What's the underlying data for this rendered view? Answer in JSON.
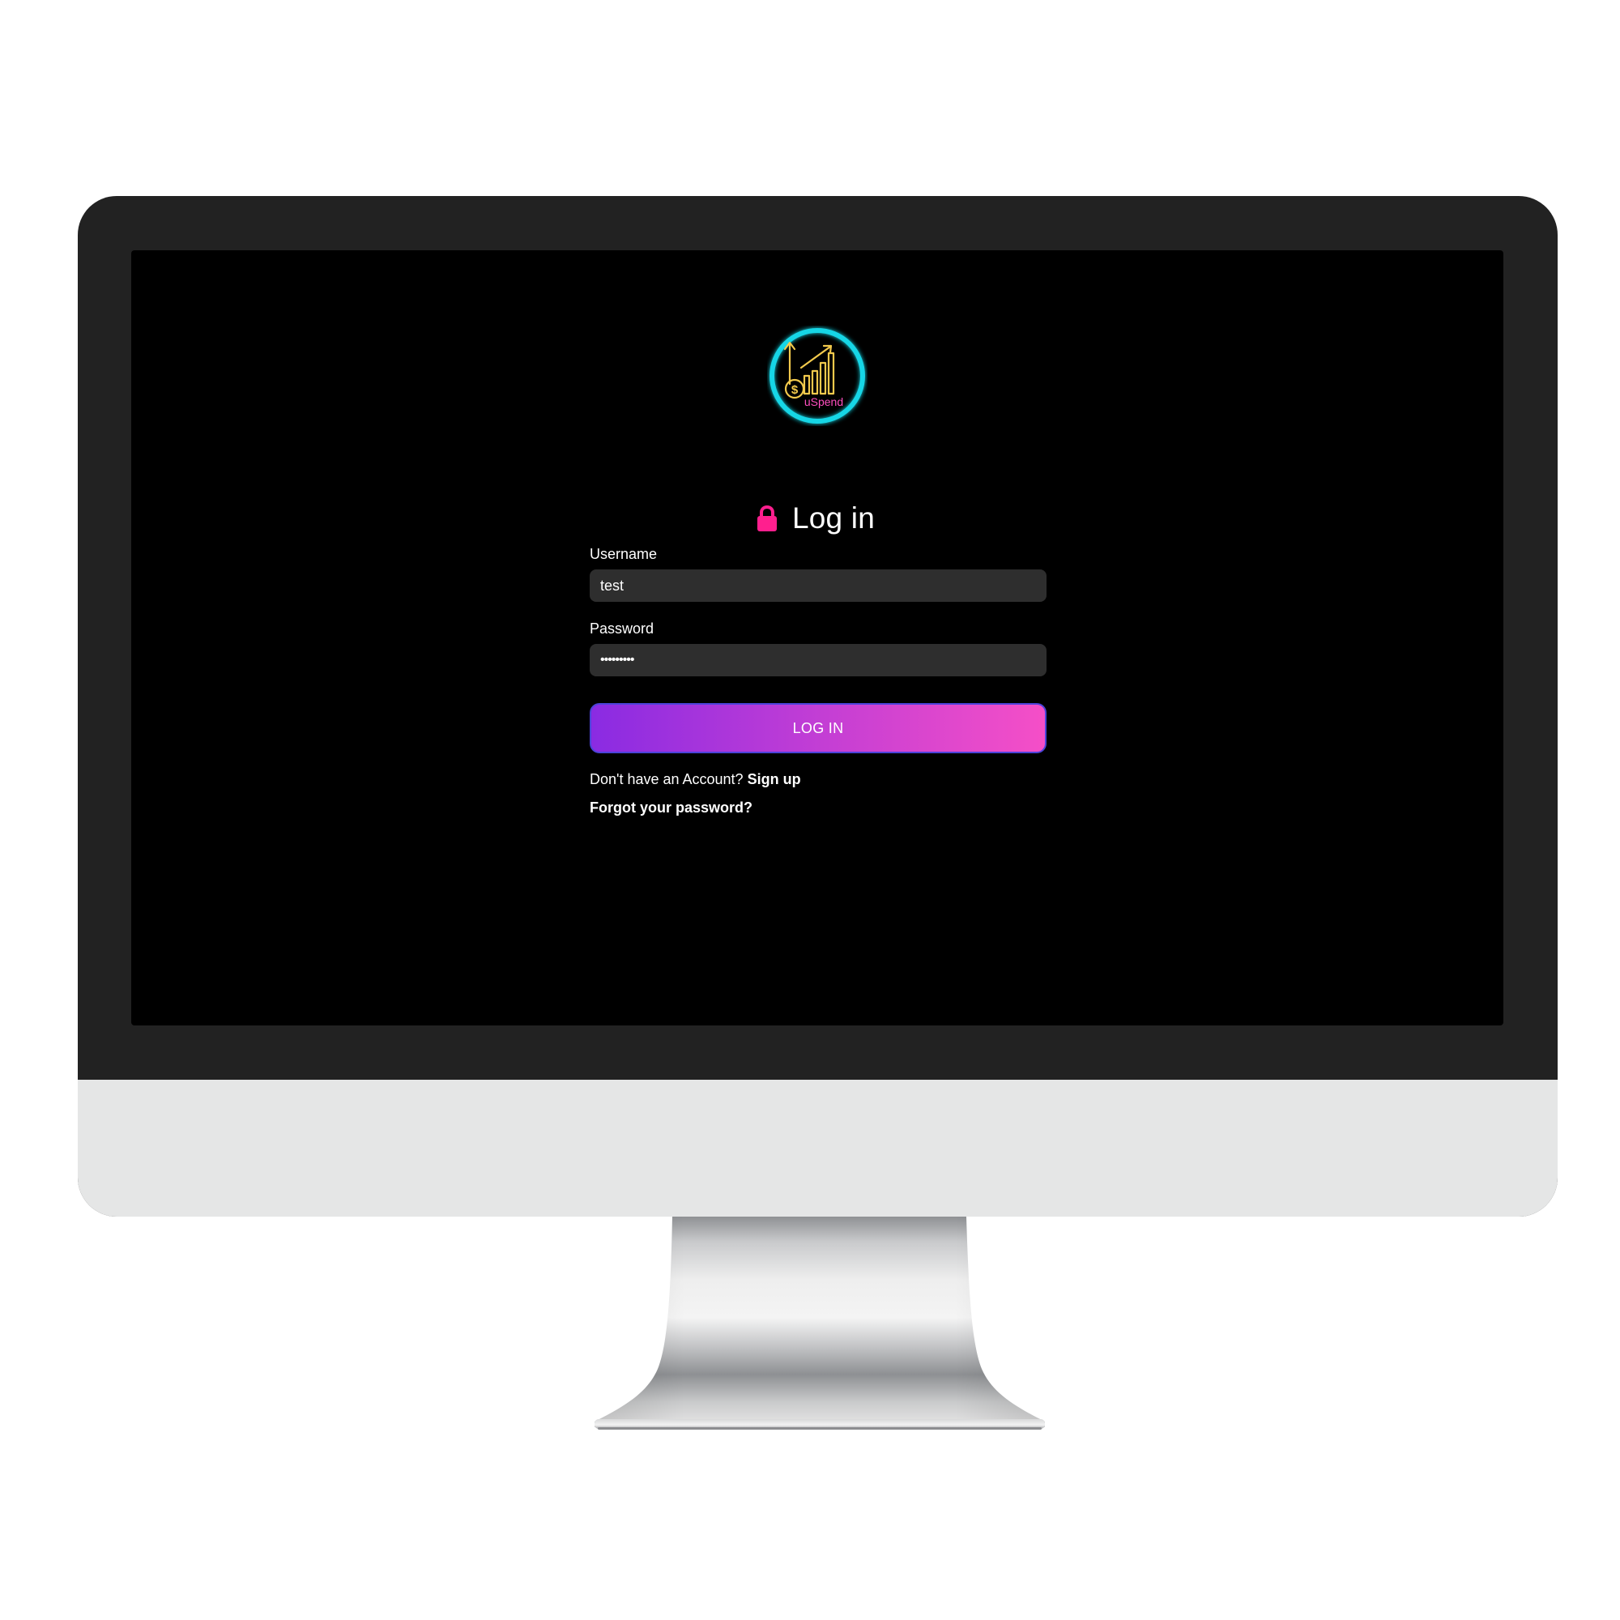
{
  "brand": {
    "logo_text": "uSpend",
    "logo_ring_color": "#19d6e6",
    "logo_icon_color": "#f2c94c",
    "logo_text_color": "#ff4fbf"
  },
  "header": {
    "title": "Log in",
    "icon": "lock-icon",
    "icon_color": "#ff1f8e"
  },
  "form": {
    "username_label": "Username",
    "username_value": "test",
    "password_label": "Password",
    "password_value": "•••••••••",
    "submit_label": "LOG IN"
  },
  "links": {
    "signup_prompt": "Don't have an Account?",
    "signup_label": "Sign up",
    "forgot_label": "Forgot your password?"
  },
  "colors": {
    "button_gradient_start": "#8a2be2",
    "button_gradient_end": "#f54fc7",
    "input_bg": "#2e2e2e",
    "screen_bg": "#000000"
  }
}
